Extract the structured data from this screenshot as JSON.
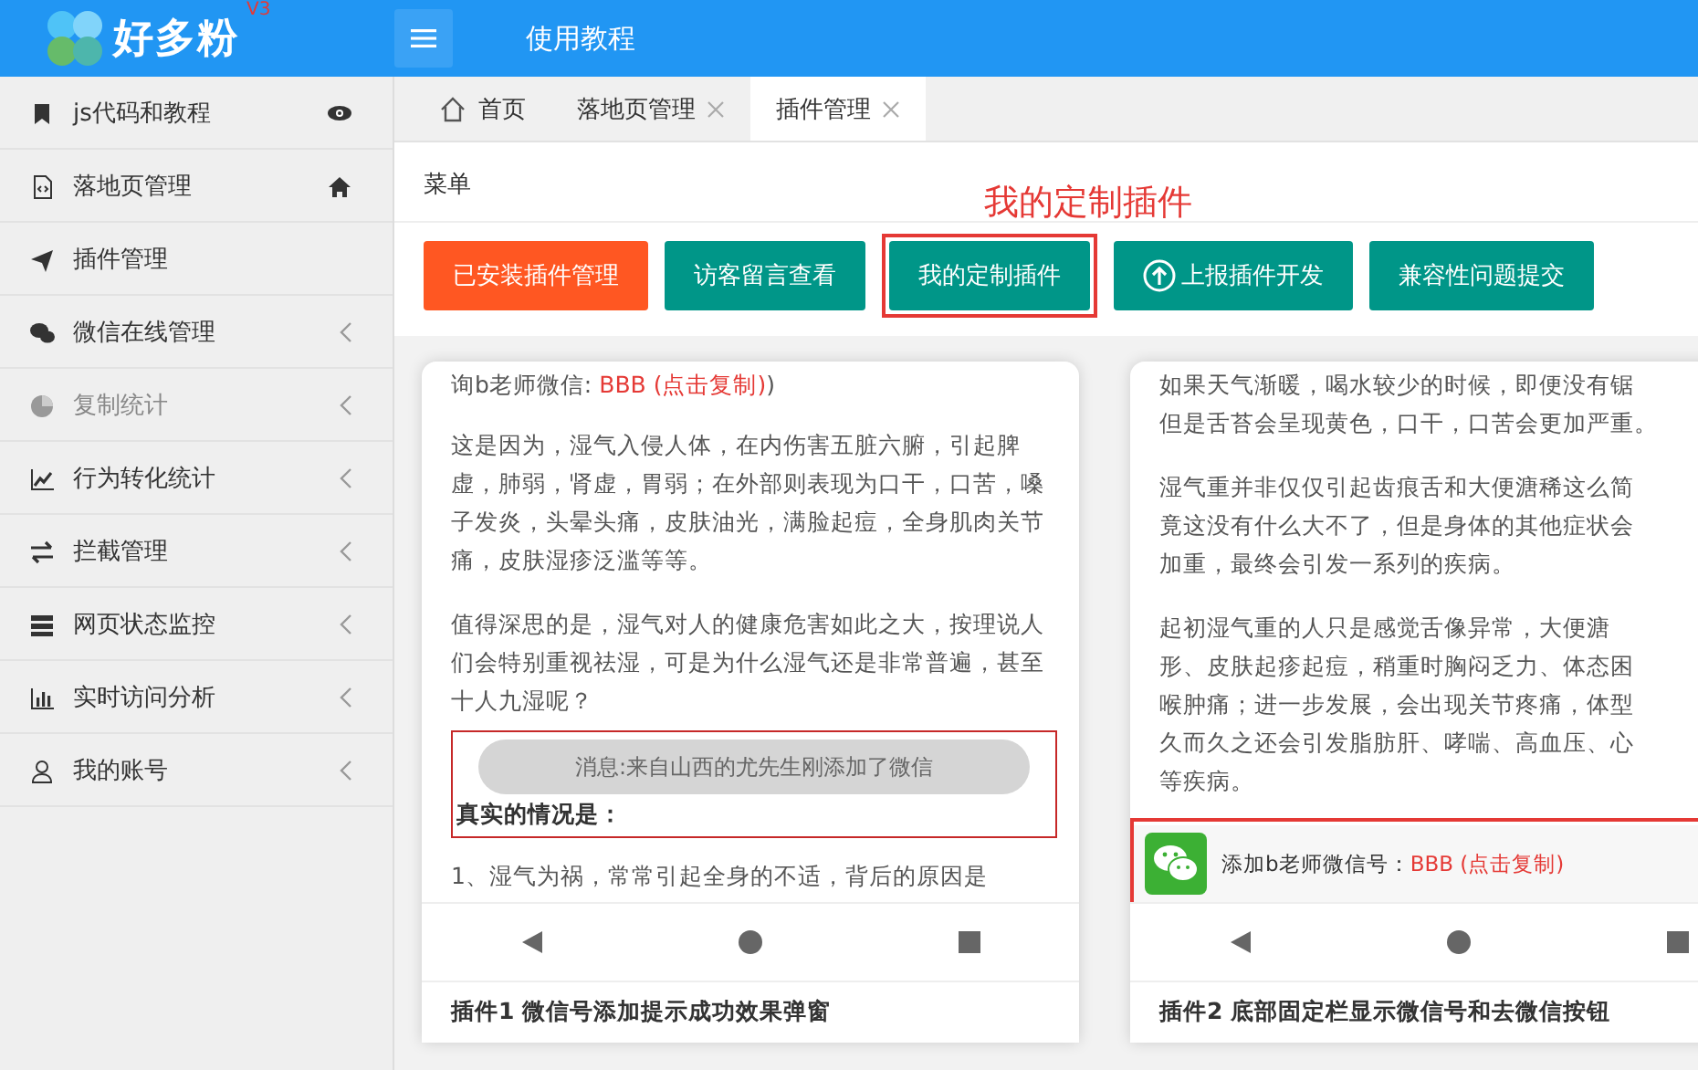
{
  "header": {
    "logo": {
      "text": "好多粉",
      "badge": "V3"
    },
    "title": "使用教程"
  },
  "sidebar": {
    "items": [
      {
        "label": "js代码和教程",
        "expandable": false,
        "disabled": false
      },
      {
        "label": "落地页管理",
        "expandable": false,
        "disabled": false
      },
      {
        "label": "插件管理",
        "expandable": false,
        "disabled": false
      },
      {
        "label": "微信在线管理",
        "expandable": true,
        "disabled": false
      },
      {
        "label": "复制统计",
        "expandable": true,
        "disabled": true
      },
      {
        "label": "行为转化统计",
        "expandable": true,
        "disabled": false
      },
      {
        "label": "拦截管理",
        "expandable": true,
        "disabled": false
      },
      {
        "label": "网页状态监控",
        "expandable": true,
        "disabled": false
      },
      {
        "label": "实时访问分析",
        "expandable": true,
        "disabled": false
      },
      {
        "label": "我的账号",
        "expandable": true,
        "disabled": false
      }
    ]
  },
  "tabs": [
    {
      "label": "首页",
      "selected": false,
      "closable": false
    },
    {
      "label": "落地页管理",
      "selected": false,
      "closable": true
    },
    {
      "label": "插件管理",
      "selected": true,
      "closable": true
    }
  ],
  "menu_label": "菜单",
  "annotation": "我的定制插件",
  "buttons": [
    {
      "label": "已安装插件管理",
      "selected": true,
      "highlighted": false
    },
    {
      "label": "访客留言查看",
      "selected": false,
      "highlighted": false
    },
    {
      "label": "我的定制插件",
      "selected": false,
      "highlighted": true
    },
    {
      "label": "上报插件开发",
      "selected": false,
      "highlighted": false
    },
    {
      "label": "兼容性问题提交",
      "selected": false,
      "highlighted": false
    }
  ],
  "cards": [
    {
      "blocks": [
        {
          "kind": "contact",
          "segments": [
            {
              "text": "询b老师微信: ",
              "accent": false
            },
            {
              "text": "BBB (点击复制)",
              "accent": true
            },
            {
              "text": ")",
              "accent": false
            }
          ]
        },
        {
          "kind": "paragraph",
          "text": "这是因为，湿气入侵人体，在内伤害五脏六腑，引起脾虚，肺弱，肾虚，胃弱；在外部则表现为口干，口苦，嗓子发炎，头晕头痛，皮肤油光，满脸起痘，全身肌肉关节痛，皮肤湿疹泛滥等等。"
        },
        {
          "kind": "paragraph",
          "text": "值得深思的是，湿气对人的健康危害如此之大，按理说人们会特别重视祛湿，可是为什么湿气还是非常普遍，甚至十人九湿呢？"
        },
        {
          "kind": "toast",
          "text": "消息:来自山西的尤先生刚添加了微信",
          "heading": "真实的情况是："
        },
        {
          "kind": "paragraph",
          "text": "1、湿气为祸，常常引起全身的不适，背后的原因是"
        }
      ],
      "caption": "插件1 微信号添加提示成功效果弹窗"
    },
    {
      "blocks": [
        {
          "kind": "lines",
          "lines": [
            "如果天气渐暖，喝水较少的时候，即便没有锯",
            "但是舌苔会呈现黄色，口干，口苦会更加严重。"
          ]
        },
        {
          "kind": "lines",
          "lines": [
            "湿气重并非仅仅引起齿痕舌和大便溏稀这么简",
            "竟这没有什么大不了，但是身体的其他症状会",
            "加重，最终会引发一系列的疾病。"
          ]
        },
        {
          "kind": "lines",
          "lines": [
            "起初湿气重的人只是感觉舌像异常，大便溏",
            "形、皮肤起疹起痘，稍重时胸闷乏力、体态困",
            "喉肿痛；进一步发展，会出现关节疼痛，体型",
            "久而久之还会引发脂肪肝、哮喘、高血压、心",
            "等疾病。"
          ]
        },
        {
          "kind": "bar",
          "label": "添加b老师微信号：",
          "accent": "BBB (点击复制)"
        }
      ],
      "caption": "插件2 底部固定栏显示微信号和去微信按钮"
    }
  ]
}
